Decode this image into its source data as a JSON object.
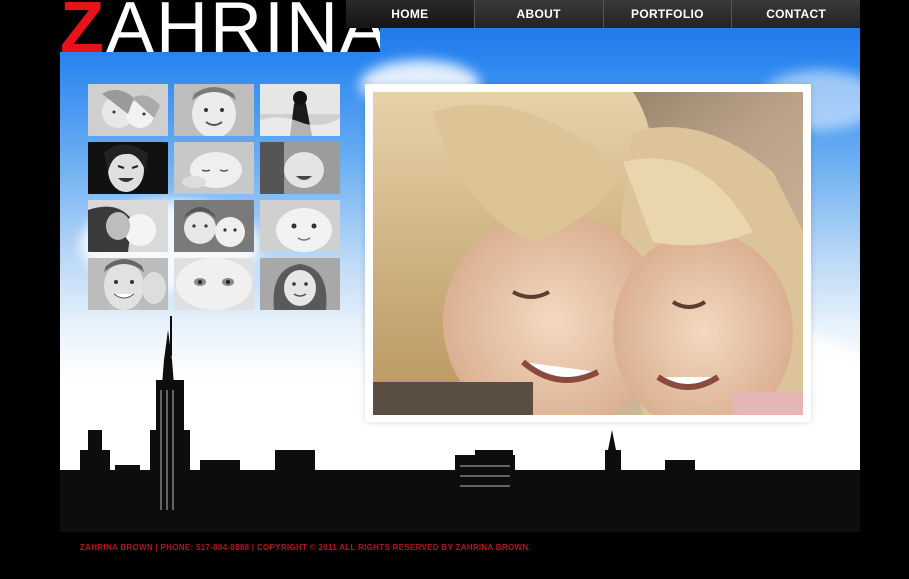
{
  "brand": {
    "first_letter": "Z",
    "rest": "AHRINA"
  },
  "nav": {
    "items": [
      {
        "label": "HOME"
      },
      {
        "label": "ABOUT"
      },
      {
        "label": "PORTFOLIO"
      },
      {
        "label": "CONTACT"
      }
    ]
  },
  "gallery": {
    "thumbnail_count": 12,
    "thumbnails": [
      "two-girls-thumbnail",
      "smiling-boy-thumbnail",
      "woman-silhouette-thumbnail",
      "laughing-woman-thumbnail",
      "sleeping-baby-thumbnail",
      "laughing-child-thumbnail",
      "father-kiss-thumbnail",
      "two-boys-thumbnail",
      "baby-face-thumbnail",
      "smiling-man-thumbnail",
      "baby-eyes-thumbnail",
      "girl-headscarf-thumbnail"
    ]
  },
  "featured": {
    "subject": "two-girls-photo"
  },
  "footer": {
    "text": "ZAHRINA BROWN | PHONE: 517-884-8888 | COPYRIGHT © 2011 ALL RIGHTS RESERVED BY ZAHRINA BROWN."
  },
  "colors": {
    "accent": "#e8121b",
    "footer_text": "#b5141c",
    "sky": "#2b86f0",
    "nav_bg": "#2a2a2a"
  }
}
